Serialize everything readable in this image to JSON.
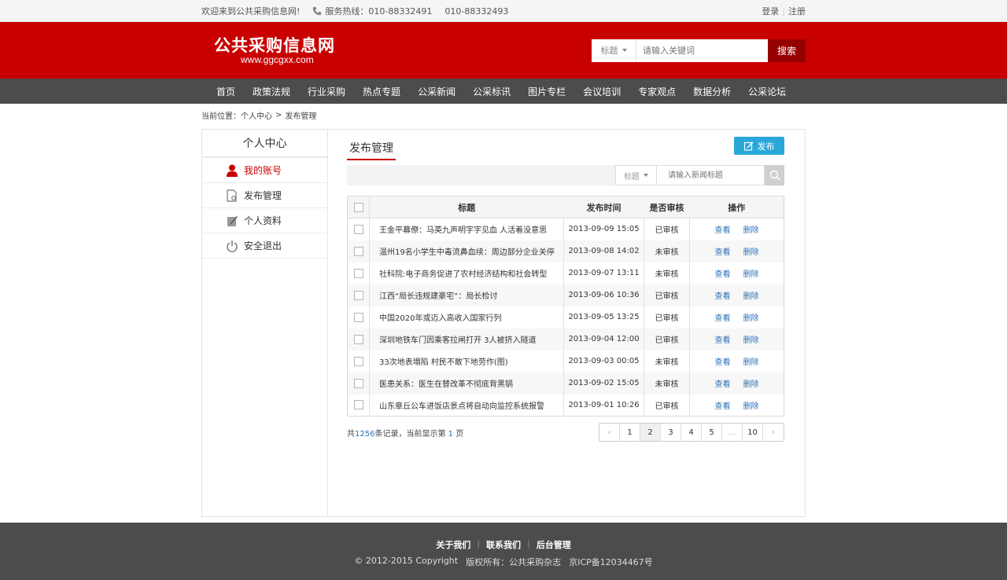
{
  "topbar": {
    "welcome": "欢迎来到公共采购信息网!",
    "hotline_label": "服务热线：010-88332491",
    "hotline_2": "010-88332493",
    "login": "登录",
    "register": "注册"
  },
  "header": {
    "logo_cn": "公共采购信息网",
    "logo_en": "www.ggcgxx.com",
    "search_category": "标题",
    "search_placeholder": "请输入关键词",
    "search_button": "搜索"
  },
  "nav": [
    "首页",
    "政策法规",
    "行业采购",
    "热点专题",
    "公采新闻",
    "公采标讯",
    "图片专栏",
    "会议培训",
    "专家观点",
    "数据分析",
    "公采论坛"
  ],
  "breadcrumb": {
    "prefix": "当前位置：",
    "level1": "个人中心",
    "sep": ">",
    "level2": "发布管理"
  },
  "sidebar": {
    "title": "个人中心",
    "items": [
      {
        "label": "我的账号",
        "icon": "user-icon",
        "active": true
      },
      {
        "label": "发布管理",
        "icon": "document-gear-icon",
        "active": false
      },
      {
        "label": "个人资料",
        "icon": "edit-document-icon",
        "active": false
      },
      {
        "label": "安全退出",
        "icon": "power-icon",
        "active": false
      }
    ]
  },
  "content": {
    "title": "发布管理",
    "publish_button": "发布",
    "filter_category": "标题",
    "filter_placeholder": "请输入新闻标题"
  },
  "table": {
    "headers": [
      "标题",
      "发布时间",
      "是否审核",
      "操作"
    ],
    "rows": [
      {
        "title": "王金平幕僚：马英九声明字字见血 人活着没意思",
        "time": "2013-09-09 15:05",
        "audit": "已审核"
      },
      {
        "title": "温州19名小学生中毒流鼻血续：周边部分企业关停",
        "time": "2013-09-08 14:02",
        "audit": "未审核"
      },
      {
        "title": "社科院:电子商务促进了农村经济结构和社会转型",
        "time": "2013-09-07 13:11",
        "audit": "未审核"
      },
      {
        "title": "江西“局长违规建豪宅”：局长检讨",
        "time": "2013-09-06 10:36",
        "audit": "已审核"
      },
      {
        "title": "中国2020年或迈入高收入国家行列",
        "time": "2013-09-05 13:25",
        "audit": "已审核"
      },
      {
        "title": "深圳地铁车门因乘客拉闸打开 3人被挤入隧道",
        "time": "2013-09-04 12:00",
        "audit": "已审核"
      },
      {
        "title": "33次地表塌陷 村民不敢下地劳作(图)",
        "time": "2013-09-03 00:05",
        "audit": "未审核"
      },
      {
        "title": "医患关系：医生在替改革不彻底背黑锅",
        "time": "2013-09-02 15:05",
        "audit": "未审核"
      },
      {
        "title": "山东章丘公车进饭店景点将自动向监控系统报警",
        "time": "2013-09-01 10:26",
        "audit": "已审核"
      }
    ],
    "view_label": "查看",
    "delete_label": "删除"
  },
  "pagination": {
    "info_prefix": "共",
    "total": "1256",
    "info_mid": "条记录，当前显示第",
    "current": "1",
    "info_suffix": "页",
    "prev": "‹",
    "pages": [
      "1",
      "2",
      "3",
      "4",
      "5",
      "...",
      "10"
    ],
    "next": "›"
  },
  "footer": {
    "links": [
      "关于我们",
      "联系我们",
      "后台管理"
    ],
    "copyright": "© 2012-2015 Copyright",
    "owner": "版权所有：公共采购杂志",
    "icp": "京ICP备12034467号"
  },
  "colors": {
    "brand_red": "#c80000",
    "nav_gray": "#4c4c4c",
    "accent_blue": "#29a7d9",
    "link_blue": "#2b72b8"
  }
}
